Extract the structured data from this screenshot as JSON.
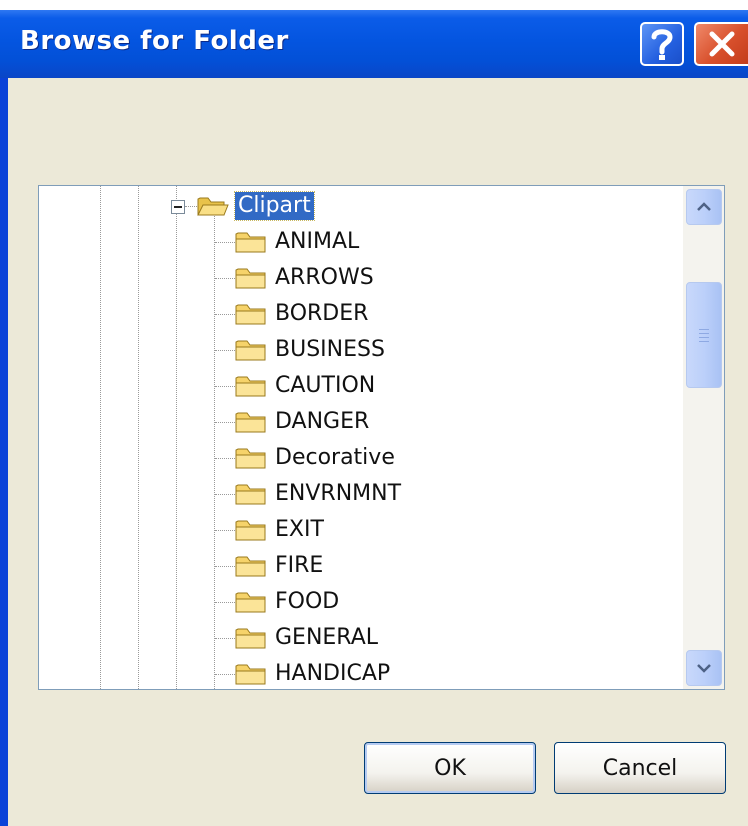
{
  "window": {
    "title": "Browse for Folder",
    "help_icon": "question-mark",
    "close_icon": "x"
  },
  "tree": {
    "selected": {
      "label": "Clipart",
      "expander": "collapse-minus"
    },
    "children": [
      {
        "label": "ANIMAL"
      },
      {
        "label": "ARROWS"
      },
      {
        "label": "BORDER"
      },
      {
        "label": "BUSINESS"
      },
      {
        "label": "CAUTION"
      },
      {
        "label": "DANGER"
      },
      {
        "label": "Decorative"
      },
      {
        "label": "ENVRNMNT"
      },
      {
        "label": "EXIT"
      },
      {
        "label": "FIRE"
      },
      {
        "label": "FOOD"
      },
      {
        "label": "GENERAL"
      },
      {
        "label": "HANDICAP"
      }
    ]
  },
  "buttons": {
    "ok": "OK",
    "cancel": "Cancel"
  },
  "colors": {
    "titlebar": "#0455e0",
    "selection": "#316ac5",
    "dialog_bg": "#ece9d8",
    "close_button": "#d8502c"
  }
}
